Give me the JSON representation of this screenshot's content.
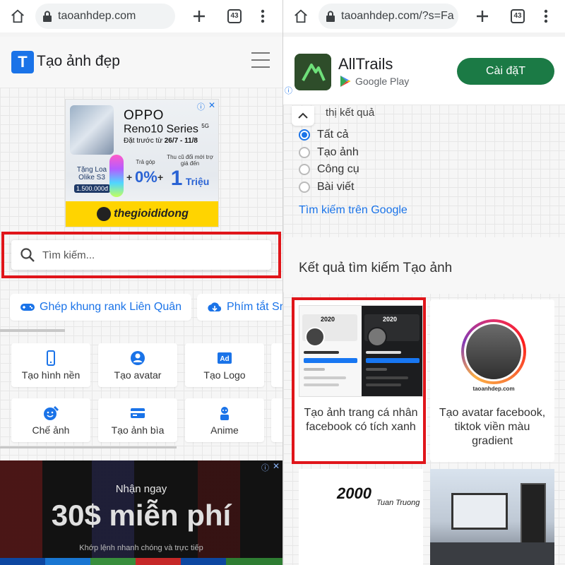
{
  "left": {
    "browser": {
      "url": "taoanhdep.com",
      "tab_count": "43"
    },
    "site": {
      "logo_letter": "T",
      "title": "Tạo ảnh đẹp"
    },
    "ad_oppo": {
      "brand": "OPPO",
      "model": "Reno10 Series",
      "model_sup": "5G",
      "preorder_prefix": "Đặt trước từ ",
      "preorder_dates": "26/7 - 11/8",
      "gift_label": "Tặng Loa Olike S3",
      "gift_price": "1.500.000đ",
      "installment_caption": "Trả góp",
      "installment_value": "0%",
      "trade_caption": "Thu cũ đổi mới trợ giá đến",
      "trade_value": "1",
      "trade_unit": "Triệu",
      "store": "thegioididong",
      "ad_info": "ⓘ",
      "ad_close": "✕"
    },
    "search": {
      "placeholder": "Tìm kiếm..."
    },
    "chips": [
      {
        "label": "Ghép khung rank Liên Quân",
        "icon": "gamepad-icon"
      },
      {
        "label": "Phím tắt Sr",
        "icon": "download-icon"
      }
    ],
    "tools": [
      {
        "label": "Tạo hình nền",
        "icon": "phone-icon"
      },
      {
        "label": "Tạo avatar",
        "icon": "user-circle-icon"
      },
      {
        "label": "Tạo Logo",
        "icon": "ad-badge-icon"
      },
      {
        "label": "Chế ảnh",
        "icon": "face-edit-icon"
      },
      {
        "label": "Tạo ảnh bìa",
        "icon": "card-icon"
      },
      {
        "label": "Anime",
        "icon": "robot-icon"
      }
    ],
    "ad_bottom": {
      "line1": "Nhận ngay",
      "headline": "30$ miễn phí",
      "sub": "Khớp lệnh nhanh chóng và trực tiếp",
      "ad_info": "ⓘ",
      "ad_close": "✕"
    },
    "colors": {
      "accent": "#1a73e8",
      "highlight": "#e0151a"
    }
  },
  "right": {
    "browser": {
      "url": "taoanhdep.com/?s=Fa",
      "tab_count": "43"
    },
    "app_ad": {
      "name": "AllTrails",
      "store": "Google Play",
      "install": "Cài đặT",
      "ad_info": "ⓘ"
    },
    "filter": {
      "title": "thị kết quả",
      "options": [
        {
          "label": "Tất cả",
          "selected": true
        },
        {
          "label": "Tạo ảnh",
          "selected": false
        },
        {
          "label": "Công cụ",
          "selected": false
        },
        {
          "label": "Bài viết",
          "selected": false
        }
      ],
      "google_link": "Tìm kiếm trên Google"
    },
    "results": {
      "heading": "Kết quả tìm kiếm Tạo ảnh",
      "cards": [
        {
          "title": "Tạo ảnh trang cá nhân facebook có tích xanh",
          "thumb_year": "2020"
        },
        {
          "title": "Tạo avatar facebook, tiktok viền màu gradient",
          "thumb_caption": "taoanhdep.com"
        }
      ],
      "bottom_cards": [
        {
          "thumb_text": "2000",
          "thumb_script": "Tuan Truong"
        },
        {
          "thumb_text": ""
        }
      ]
    },
    "colors": {
      "install_btn": "#1b7a45",
      "radio_on": "#1a73e8"
    }
  }
}
